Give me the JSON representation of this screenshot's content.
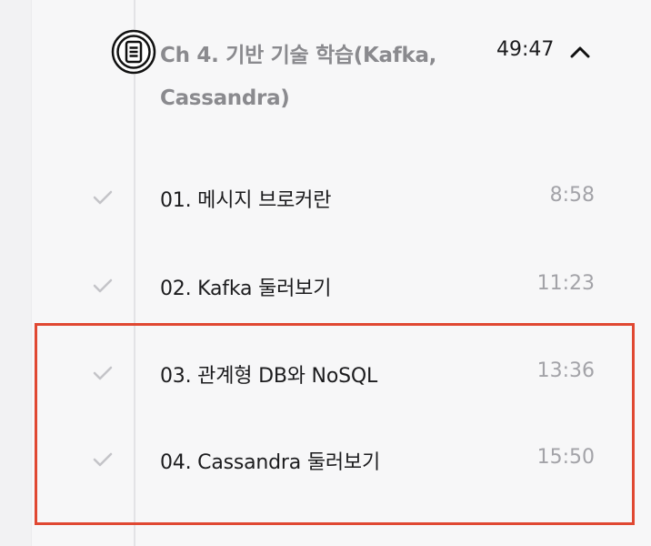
{
  "chapter": {
    "title": "Ch 4. 기반 기술 학습(Kafka, Cassandra)",
    "duration": "49:47",
    "toggle_icon": "chevron-up-icon",
    "icon": "document-list-icon"
  },
  "lectures": [
    {
      "title": "01. 메시지 브로커란",
      "duration": "8:58",
      "completed": true
    },
    {
      "title": "02. Kafka 둘러보기",
      "duration": "11:23",
      "completed": true
    },
    {
      "title": "03. 관계형 DB와 NoSQL",
      "duration": "13:36",
      "completed": true
    },
    {
      "title": "04. Cassandra 둘러보기",
      "duration": "15:50",
      "completed": true
    }
  ],
  "colors": {
    "highlight": "#e04832",
    "check": "#c4c4c8",
    "chapter_title": "#8a8a8e",
    "duration": "#a3a3a8"
  }
}
